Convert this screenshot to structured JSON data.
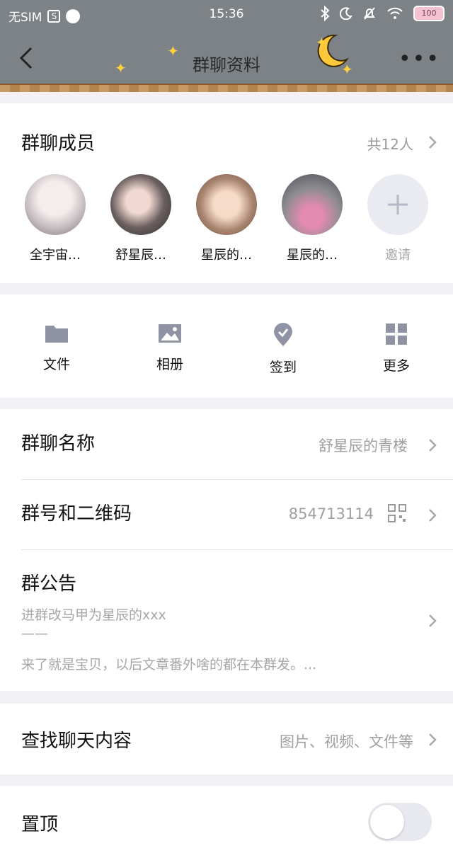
{
  "status_bar": {
    "carrier": "无SIM",
    "time": "15:36",
    "battery_label": "100"
  },
  "header": {
    "title": "群聊资料"
  },
  "members_section": {
    "title": "群聊成员",
    "count": "共12人",
    "members": [
      {
        "name": "全宇宙…"
      },
      {
        "name": "舒星辰…"
      },
      {
        "name": "星辰的…"
      },
      {
        "name": "星辰的…"
      }
    ],
    "invite_label": "邀请"
  },
  "actions": [
    {
      "label": "文件",
      "icon": "folder-icon"
    },
    {
      "label": "相册",
      "icon": "image-icon"
    },
    {
      "label": "签到",
      "icon": "checkin-icon"
    },
    {
      "label": "更多",
      "icon": "grid-icon"
    }
  ],
  "info": {
    "group_name_label": "群聊名称",
    "group_name_value": "舒星辰的青楼",
    "group_id_label": "群号和二维码",
    "group_id_value": "854713114",
    "notice_label": "群公告",
    "notice_line1": "进群改马甲为星辰的xxx",
    "notice_line2": "——",
    "notice_line3": "来了就是宝贝，以后文章番外啥的都在本群发。..."
  },
  "search": {
    "label": "查找聊天内容",
    "hint": "图片、视频、文件等"
  },
  "pin": {
    "label": "置顶",
    "enabled": false
  },
  "colors": {
    "header_bg": "#7d8287",
    "icon_color": "#8f93a3",
    "muted_text": "#a0a0a0"
  }
}
